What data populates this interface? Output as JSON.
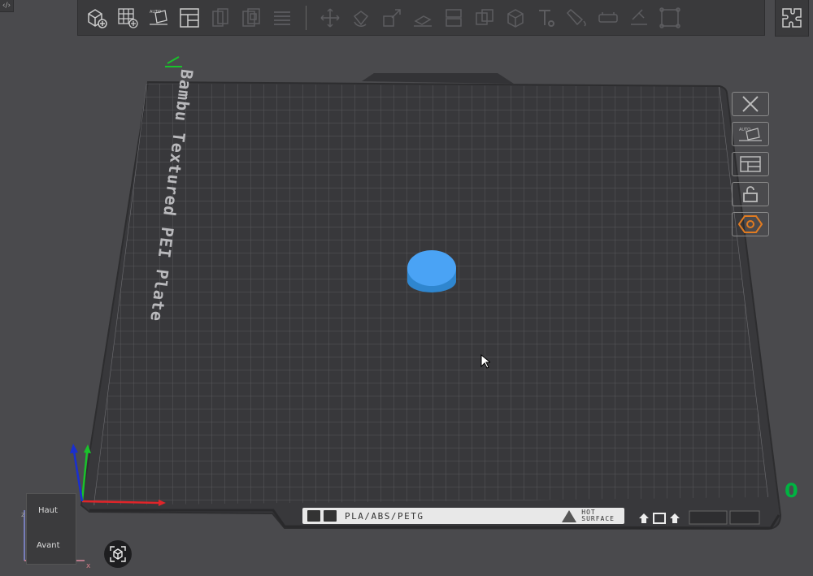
{
  "corner_toggle": "‹/›",
  "toolbar": {
    "tools": [
      {
        "name": "add-object-icon"
      },
      {
        "name": "add-plate-icon"
      },
      {
        "name": "auto-orient-icon"
      },
      {
        "name": "arrange-icon"
      },
      {
        "name": "split-objects-icon"
      },
      {
        "name": "split-parts-icon"
      },
      {
        "name": "layers-icon"
      },
      {
        "name": "move-icon"
      },
      {
        "name": "rotate-icon"
      },
      {
        "name": "scale-icon"
      },
      {
        "name": "lay-on-face-icon"
      },
      {
        "name": "cut-icon"
      },
      {
        "name": "mesh-boolean-icon"
      },
      {
        "name": "support-paint-icon"
      },
      {
        "name": "text-shape-icon"
      },
      {
        "name": "color-paint-icon"
      },
      {
        "name": "assembly-icon"
      },
      {
        "name": "measure-icon"
      },
      {
        "name": "emboss-icon"
      }
    ]
  },
  "plate": {
    "name": "Bambu Textured PEI Plate",
    "material_label": "PLA/ABS/PETG",
    "hot_surface": "HOT\nSURFACE"
  },
  "plate_tools": [
    {
      "name": "delete-plate-icon"
    },
    {
      "name": "auto-orient-plate-icon"
    },
    {
      "name": "arrange-plate-icon"
    },
    {
      "name": "lock-plate-icon"
    },
    {
      "name": "plate-settings-icon"
    }
  ],
  "plate_index": "0",
  "view_cube": {
    "top": "Haut",
    "front": "Avant"
  },
  "axes": {
    "x": "x",
    "z": "z"
  },
  "colors": {
    "object": "#4aa3f5",
    "accent_orange": "#e07b21",
    "axis_x": "#e0252a",
    "axis_y": "#19c22b",
    "axis_z": "#1a2fd0",
    "plate_index": "#00b341"
  }
}
